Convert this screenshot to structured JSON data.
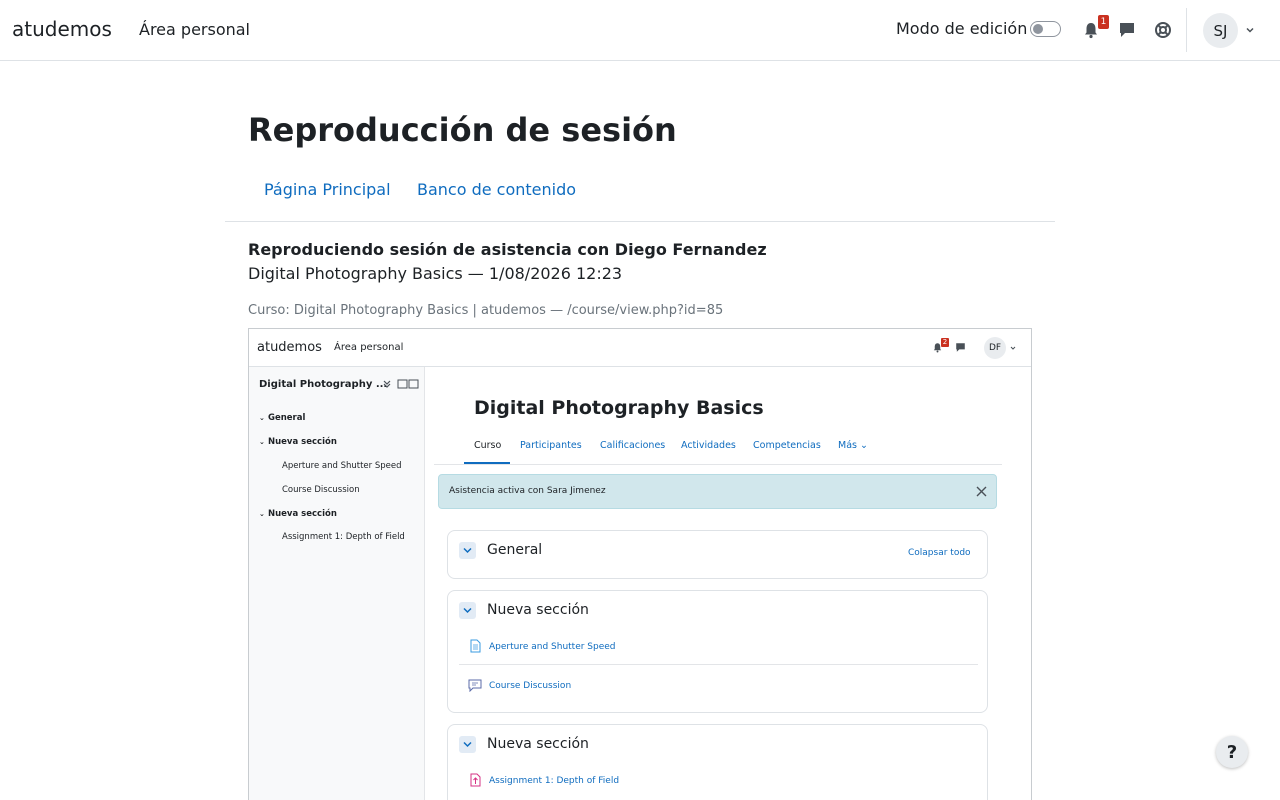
{
  "navbar": {
    "brand": "atudemos",
    "personal_area": "Área personal",
    "edit_mode_label": "Modo de edición",
    "notifications_count": "1",
    "user_initials": "SJ"
  },
  "page": {
    "title": "Reproducción de sesión",
    "tabs": [
      "Página Principal",
      "Banco de contenido"
    ],
    "session_heading": "Reproduciendo sesión de asistencia con Diego Fernandez",
    "session_subheading": "Digital Photography Basics — 1/08/2026 12:23",
    "course_path": "Curso: Digital Photography Basics | atudemos — /course/view.php?id=85"
  },
  "replay": {
    "brand": "atudemos",
    "personal_area": "Área personal",
    "notifications_count": "2",
    "user_initials": "DF",
    "drawer": {
      "title": "Digital Photography ...",
      "items": [
        {
          "label": "General",
          "type": "section"
        },
        {
          "label": "Nueva sección",
          "type": "section"
        },
        {
          "label": "Aperture and Shutter Speed",
          "type": "activity"
        },
        {
          "label": "Course Discussion",
          "type": "activity"
        },
        {
          "label": "Nueva sección",
          "type": "section"
        },
        {
          "label": "Assignment 1: Depth of Field",
          "type": "activity"
        }
      ]
    },
    "course_title": "Digital Photography Basics",
    "tabs": [
      {
        "label": "Curso",
        "active": true
      },
      {
        "label": "Participantes",
        "active": false
      },
      {
        "label": "Calificaciones",
        "active": false
      },
      {
        "label": "Actividades",
        "active": false
      },
      {
        "label": "Competencias",
        "active": false
      },
      {
        "label": "Más",
        "active": false
      }
    ],
    "alert_text": "Asistencia activa con Sara Jimenez",
    "collapse_all": "Colapsar todo",
    "sections": [
      {
        "title": "General",
        "activities": []
      },
      {
        "title": "Nueva sección",
        "activities": [
          {
            "label": "Aperture and Shutter Speed",
            "icon": "page-icon"
          },
          {
            "label": "Course Discussion",
            "icon": "forum-icon"
          }
        ]
      },
      {
        "title": "Nueva sección",
        "activities": [
          {
            "label": "Assignment 1: Depth of Field",
            "icon": "assignment-icon"
          }
        ]
      }
    ]
  },
  "help_label": "?",
  "colors": {
    "link": "#0f6cbf",
    "badge": "#ca3120",
    "alert_bg": "#d1e7ec"
  }
}
